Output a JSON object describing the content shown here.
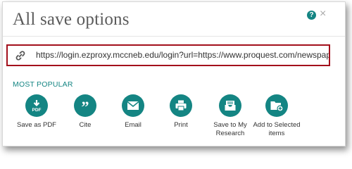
{
  "dialog": {
    "title": "All save options",
    "help_glyph": "?",
    "close_glyph": "×"
  },
  "url": {
    "icon": "link-icon",
    "value": "https://login.ezproxy.mccneb.edu/login?url=https://www.proquest.com/newspape"
  },
  "section": {
    "label": "MOST POPULAR"
  },
  "options": [
    {
      "label": "Save as PDF",
      "icon": "download-pdf-icon"
    },
    {
      "label": "Cite",
      "icon": "quote-icon"
    },
    {
      "label": "Email",
      "icon": "envelope-icon"
    },
    {
      "label": "Print",
      "icon": "printer-icon"
    },
    {
      "label": "Save to My Research",
      "icon": "inbox-tray-icon"
    },
    {
      "label": "Add to Selected items",
      "icon": "folder-add-icon"
    }
  ],
  "colors": {
    "accent": "#148583",
    "highlight_border": "#a3101c"
  }
}
